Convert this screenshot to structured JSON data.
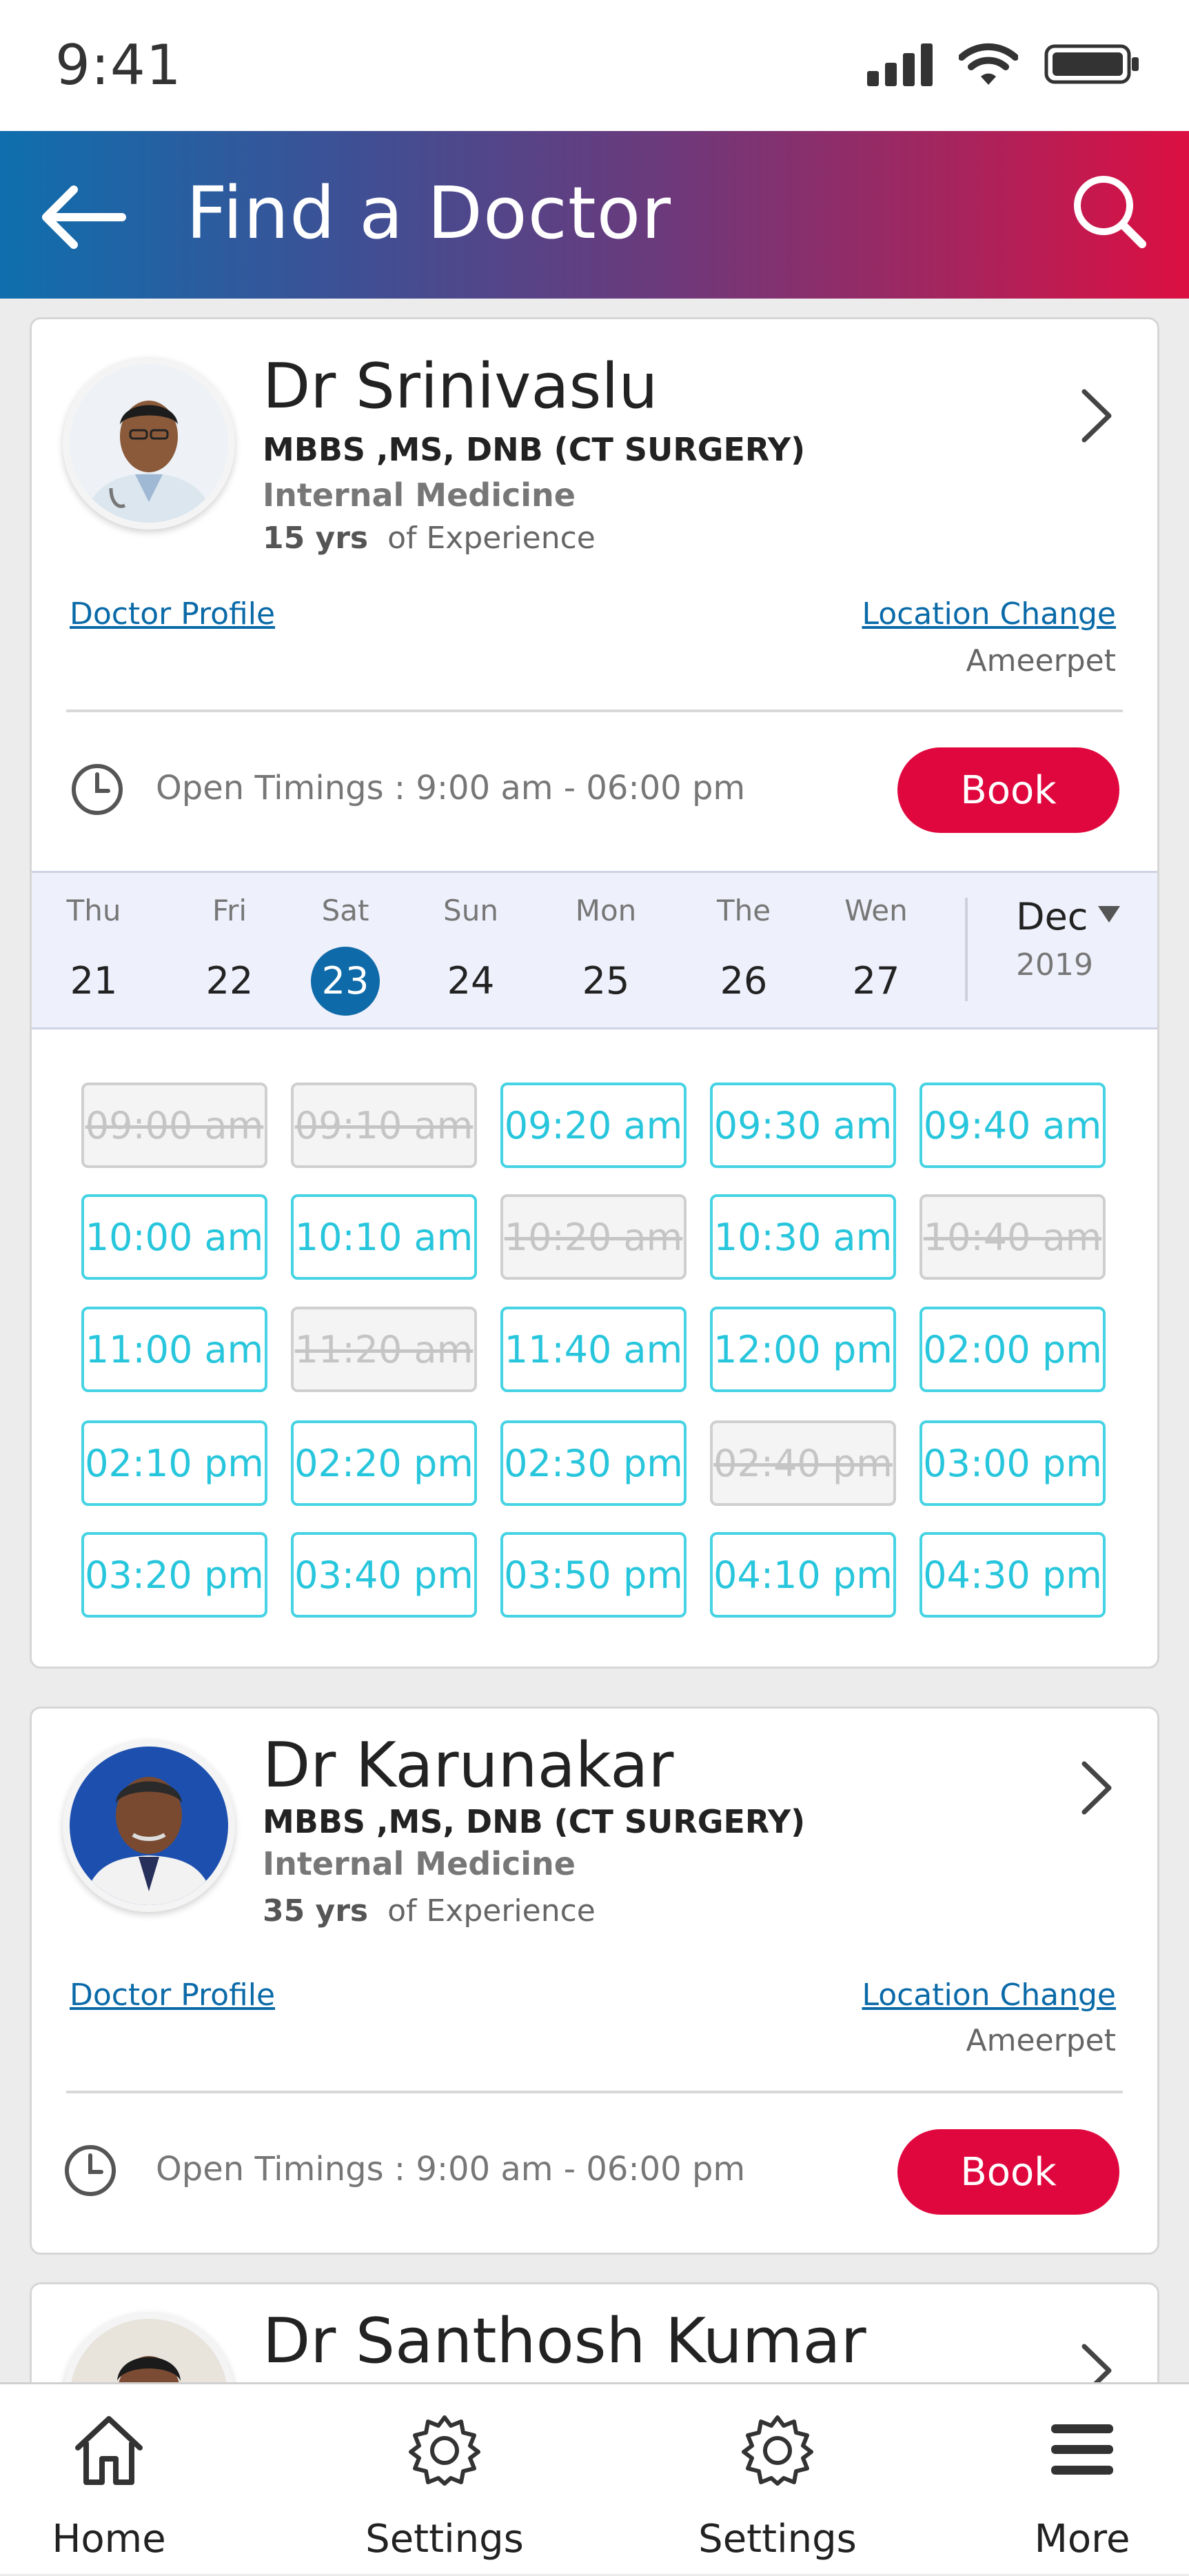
{
  "status_bar": {
    "time": "9:41"
  },
  "header": {
    "title": "Find a Doctor"
  },
  "doctors": [
    {
      "name": "Dr Srinivaslu",
      "degree": "MBBS ,MS, DNB (CT SURGERY)",
      "department": "Internal Medicine",
      "experience_years": "15 yrs",
      "experience_suffix": "of Experience",
      "profile_link": "Doctor Profile",
      "location_link": "Location Change",
      "location": "Ameerpet",
      "timings": "Open Timings : 9:00 am - 06:00 pm",
      "book_label": "Book"
    },
    {
      "name": "Dr Karunakar",
      "degree": "MBBS ,MS, DNB (CT SURGERY)",
      "department": "Internal Medicine",
      "experience_years": "35 yrs",
      "experience_suffix": "of Experience",
      "profile_link": "Doctor Profile",
      "location_link": "Location Change",
      "location": "Ameerpet",
      "timings": "Open Timings : 9:00 am - 06:00 pm",
      "book_label": "Book"
    },
    {
      "name": "Dr Santhosh Kumar"
    }
  ],
  "calendar": {
    "days": [
      {
        "name": "Thu",
        "date": "21",
        "selected": false
      },
      {
        "name": "Fri",
        "date": "22",
        "selected": false
      },
      {
        "name": "Sat",
        "date": "23",
        "selected": true
      },
      {
        "name": "Sun",
        "date": "24",
        "selected": false
      },
      {
        "name": "Mon",
        "date": "25",
        "selected": false
      },
      {
        "name": "The",
        "date": "26",
        "selected": false
      },
      {
        "name": "Wen",
        "date": "27",
        "selected": false
      }
    ],
    "month": "Dec",
    "year": "2019"
  },
  "slots": [
    {
      "time": "09:00 am",
      "available": false
    },
    {
      "time": "09:10 am",
      "available": false
    },
    {
      "time": "09:20 am",
      "available": true
    },
    {
      "time": "09:30 am",
      "available": true
    },
    {
      "time": "09:40 am",
      "available": true
    },
    {
      "time": "10:00 am",
      "available": true
    },
    {
      "time": "10:10 am",
      "available": true
    },
    {
      "time": "10:20 am",
      "available": false
    },
    {
      "time": "10:30 am",
      "available": true
    },
    {
      "time": "10:40 am",
      "available": false
    },
    {
      "time": "11:00 am",
      "available": true
    },
    {
      "time": "11:20 am",
      "available": false
    },
    {
      "time": "11:40 am",
      "available": true
    },
    {
      "time": "12:00 pm",
      "available": true
    },
    {
      "time": "02:00 pm",
      "available": true
    },
    {
      "time": "02:10 pm",
      "available": true
    },
    {
      "time": "02:20 pm",
      "available": true
    },
    {
      "time": "02:30 pm",
      "available": true
    },
    {
      "time": "02:40 pm",
      "available": false
    },
    {
      "time": "03:00 pm",
      "available": true
    },
    {
      "time": "03:20 pm",
      "available": true
    },
    {
      "time": "03:40 pm",
      "available": true
    },
    {
      "time": "03:50 pm",
      "available": true
    },
    {
      "time": "04:10 pm",
      "available": true
    },
    {
      "time": "04:30 pm",
      "available": true
    }
  ],
  "tabbar": [
    {
      "label": "Home",
      "icon": "home-icon"
    },
    {
      "label": "Settings",
      "icon": "gear-icon"
    },
    {
      "label": "Settings",
      "icon": "gear-icon"
    },
    {
      "label": "More",
      "icon": "menu-icon"
    }
  ],
  "colors": {
    "brand_blue": "#0e6aa8",
    "book_red": "#e0073e",
    "slot_cyan": "#46d3e3"
  }
}
